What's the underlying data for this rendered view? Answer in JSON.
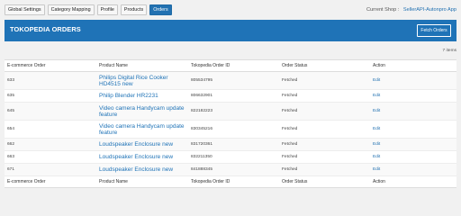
{
  "tabs": [
    "Global Settings",
    "Category Mapping",
    "Profile",
    "Products",
    "Orders"
  ],
  "active_tab_index": 4,
  "shop": {
    "label": "Current Shop :",
    "name": "SellerAPI-Autonpro App"
  },
  "header": {
    "title": "TOKOPEDIA ORDERS",
    "fetch_button": "Fetch Orders"
  },
  "item_count": "7 items",
  "columns": [
    "E-commerce Order",
    "Product Name",
    "Tokopedia Order ID",
    "Order Status",
    "Action"
  ],
  "rows": [
    {
      "ecommerce_order": "633",
      "product_name": "Philips Digital Rice Cooker HD4515 new",
      "tokopedia_order_id": "805534795",
      "order_status": "Fetched",
      "action": "Edit"
    },
    {
      "ecommerce_order": "635",
      "product_name": "Philip Blender HR2231",
      "tokopedia_order_id": "806632901",
      "order_status": "Fetched",
      "action": "Edit"
    },
    {
      "ecommerce_order": "645",
      "product_name": "Video camera Handycam update feature",
      "tokopedia_order_id": "822182223",
      "order_status": "Fetched",
      "action": "Edit"
    },
    {
      "ecommerce_order": "654",
      "product_name": "Video camera Handycam update feature",
      "tokopedia_order_id": "830345216",
      "order_status": "Fetched",
      "action": "Edit"
    },
    {
      "ecommerce_order": "662",
      "product_name": "Loudspeaker Enclosure new",
      "tokopedia_order_id": "831720361",
      "order_status": "Fetched",
      "action": "Edit"
    },
    {
      "ecommerce_order": "663",
      "product_name": "Loudspeaker Enclosure new",
      "tokopedia_order_id": "832211350",
      "order_status": "Fetched",
      "action": "Edit"
    },
    {
      "ecommerce_order": "671",
      "product_name": "Loudspeaker Enclosure new",
      "tokopedia_order_id": "841888345",
      "order_status": "Fetched",
      "action": "Edit"
    }
  ]
}
